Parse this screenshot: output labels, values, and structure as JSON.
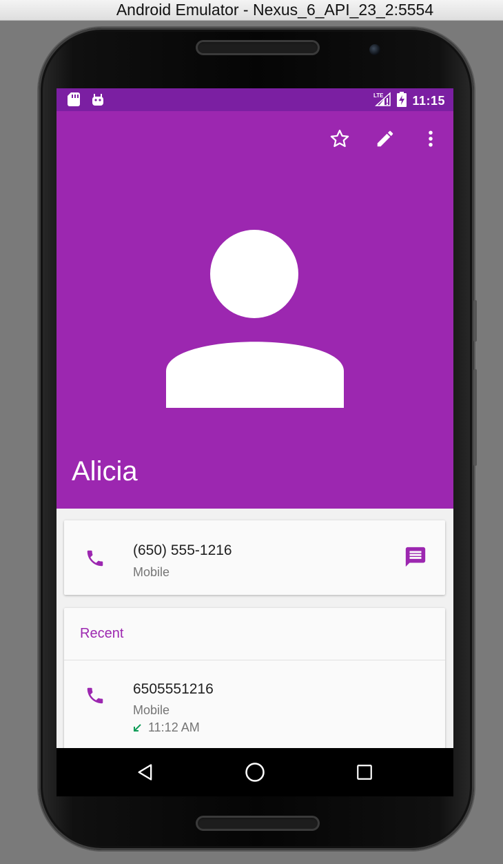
{
  "window": {
    "title": "Android Emulator - Nexus_6_API_23_2:5554"
  },
  "status_bar": {
    "time": "11:15",
    "network": "LTE"
  },
  "header": {
    "contact_name": "Alicia",
    "background_color": "#9c27b0",
    "actions": [
      "star-icon",
      "edit-icon",
      "more-vert-icon"
    ]
  },
  "phone_card": {
    "number": "(650) 555-1216",
    "type": "Mobile",
    "call_icon": "phone-icon",
    "message_icon": "message-icon"
  },
  "recent": {
    "title": "Recent",
    "items": [
      {
        "number": "6505551216",
        "type": "Mobile",
        "time": "11:12 AM",
        "direction_icon": "incoming-call-arrow-icon"
      }
    ]
  },
  "nav_bar": {
    "buttons": [
      "back-icon",
      "home-icon",
      "recents-icon"
    ]
  },
  "colors": {
    "accent": "#9c27b0",
    "status_bar": "#7b1fa2",
    "incoming_call": "#0f9d58"
  }
}
